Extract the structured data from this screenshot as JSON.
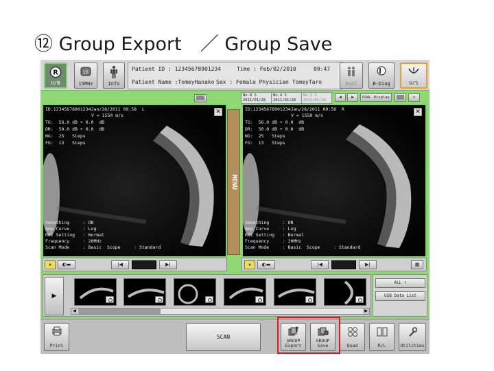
{
  "slide": {
    "title": "⑫ Group Export　／ Group Save"
  },
  "topbar": {
    "ub_label": "U/B",
    "freq_value": "15",
    "freq_label": "15MHz",
    "info_label": "Info",
    "bdiag_label": "B-Diag",
    "us_label": "U/S",
    "patient_id_label": "Patient ID : 12345678901234",
    "time_label": "Time : Feb/02/2010",
    "time_value": "09:47",
    "patient_name_label": "Patient Name :TomeyHanako",
    "sex_label": "Sex : Female Physician TomeyTaro",
    "dual_label": "Dual"
  },
  "panel_header": {
    "tab1_top": "No.8 S",
    "tab1_bottom": "2011/01/28",
    "tab2_top": "No.4 S",
    "tab2_bottom": "2011/01/28",
    "tab3_top": "No.5 S",
    "tab3_bottom": "2011/01/28",
    "dual_display_label": "DUAL Display"
  },
  "left_image": {
    "header": "ID:12345678901234Jan/28/2011 09:58  L",
    "velocity": "V = 1550 m/s",
    "tg": "TG:  56.0 dB + 0.0  dB",
    "dr": "DR:  50.0 dB + 0.0  dB",
    "ng": "NG:  25   Steps",
    "fg": "FG:  13   Steps",
    "smoothing": "Smoothing     : ON",
    "amp_curve": "Amp Curve     : Log",
    "roi_setting": "ROI Setting   : Normal",
    "frequency": "Frequency     : 20MHz",
    "scan_mode": "Scan Mode     : Basic  Scope     : Standard"
  },
  "right_image": {
    "header": "ID:12345678901234Jan/28/2011 09:58  R",
    "velocity": "V = 1550 m/s",
    "tg": "TG:  56.0 dB + 0.0  dB",
    "dr": "DR:  50.0 dB + 0.0  dB",
    "ng": "NG:  25   Steps",
    "fg": "FG:  13   Steps",
    "smoothing": "Smoothing     : ON",
    "amp_curve": "Amp Curve     : Log",
    "roi_setting": "ROI Setting   : Normal",
    "frequency": "Frequency     : 20MHz",
    "scan_mode": "Scan Mode     : Basic  Scope     : Standard"
  },
  "menu_tab": {
    "label": "MENU"
  },
  "thumbnails": {
    "all_label": "ALL",
    "usb_label": "USB Data List"
  },
  "bottombar": {
    "print_label": "Print",
    "scan_label": "SCAN",
    "group_export_line1": "GROUP",
    "group_export_line2": "Export",
    "group_save_line1": "GROUP",
    "group_save_line2": "Save",
    "quad_label": "Quad",
    "rl_label": "R/L",
    "utilities_label": "Utilities"
  },
  "colors": {
    "frame": "#8ed973",
    "highlight": "#e3151a",
    "us_border": "#ef9d20",
    "menu": "#b28f5f"
  }
}
